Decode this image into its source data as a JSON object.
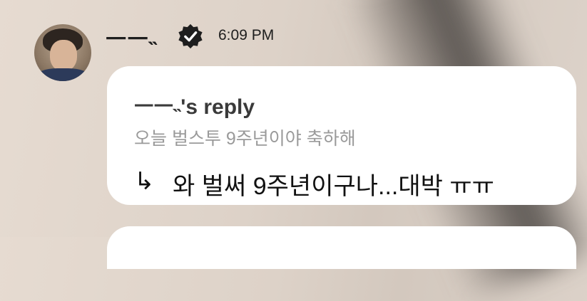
{
  "message": {
    "username": "ㅡㅡ˵",
    "time": "6:09 PM",
    "verified_icon": "verified-badge-icon",
    "avatar_icon": "avatar-photo",
    "reply_card": {
      "header": "ㅡㅡ˵'s reply",
      "quoted_text": "오늘 벌스투 9주년이야 축하해",
      "reply_arrow": "↳",
      "reply_text": "와 벌써 9주년이구나...대박 ㅠㅠ"
    }
  },
  "colors": {
    "background": "#e2d7cd",
    "card": "#ffffff",
    "text_primary": "#111111",
    "text_secondary": "#9a9a9a"
  }
}
